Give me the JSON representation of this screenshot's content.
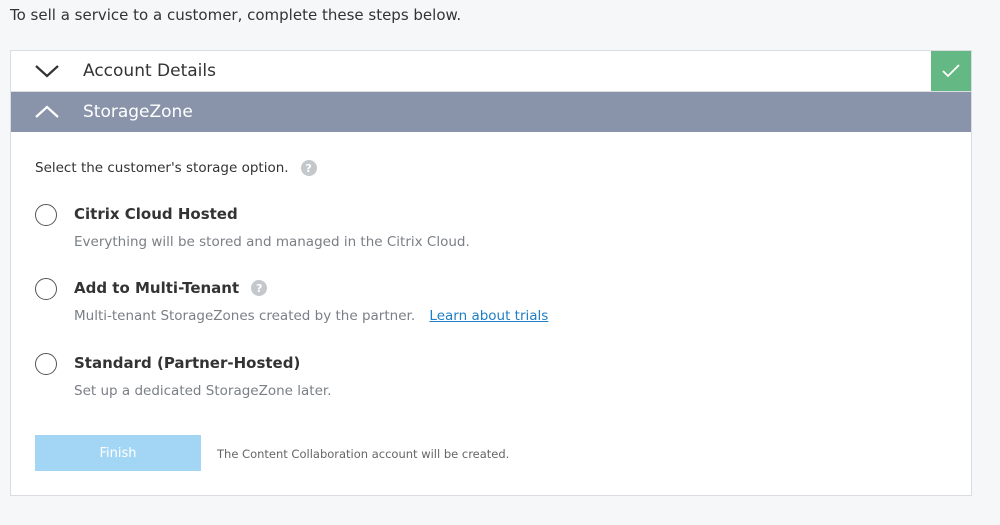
{
  "intro": "To sell a service to a customer, complete these steps below.",
  "accordion": {
    "account_details": {
      "title": "Account Details",
      "completed": true
    },
    "storagezone": {
      "title": "StorageZone",
      "expanded": true
    }
  },
  "storage": {
    "prompt": "Select the customer's storage option.",
    "help_glyph": "?",
    "options": [
      {
        "label": "Citrix Cloud Hosted",
        "description": "Everything will be stored and managed in the Citrix Cloud.",
        "selected": false
      },
      {
        "label": "Add to Multi-Tenant",
        "description": "Multi-tenant StorageZones created by the partner.",
        "link": "Learn about trials",
        "selected": false
      },
      {
        "label": "Standard (Partner-Hosted)",
        "description": "Set up a dedicated StorageZone later.",
        "selected": false
      }
    ]
  },
  "finish": {
    "label": "Finish",
    "note": "The Content Collaboration account will be created.",
    "enabled": false
  },
  "colors": {
    "accent_complete": "#63b883",
    "active_header": "#8994aa",
    "link": "#1f7fc4",
    "disabled_button": "#a3d6f5"
  }
}
